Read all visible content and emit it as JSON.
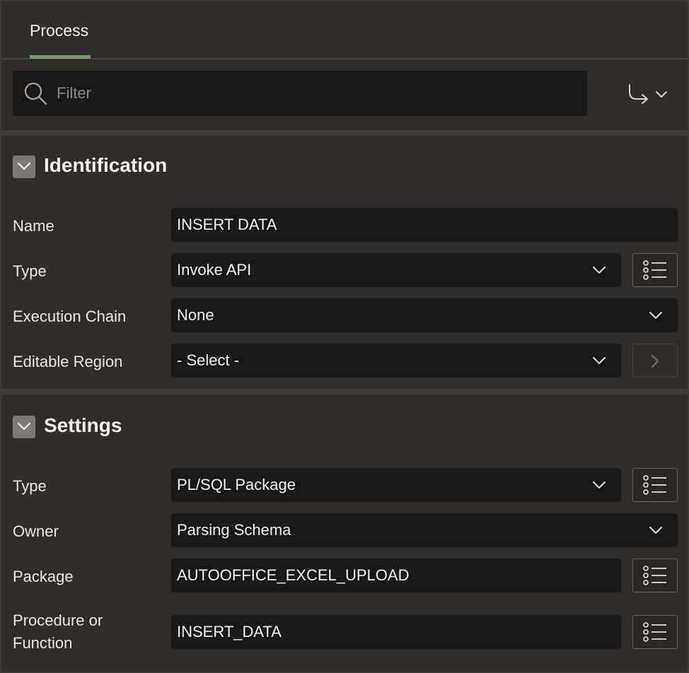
{
  "tabs": [
    {
      "label": "Process",
      "active": true
    }
  ],
  "filter": {
    "placeholder": "Filter"
  },
  "sections": {
    "identification": {
      "title": "Identification",
      "fields": {
        "name": {
          "label": "Name",
          "value": "INSERT DATA"
        },
        "type": {
          "label": "Type",
          "value": "Invoke API"
        },
        "execution_chain": {
          "label": "Execution Chain",
          "value": "None"
        },
        "editable_region": {
          "label": "Editable Region",
          "value": "- Select -"
        }
      }
    },
    "settings": {
      "title": "Settings",
      "fields": {
        "type": {
          "label": "Type",
          "value": "PL/SQL Package"
        },
        "owner": {
          "label": "Owner",
          "value": "Parsing Schema"
        },
        "package": {
          "label": "Package",
          "value": "AUTOOFFICE_EXCEL_UPLOAD"
        },
        "procedure": {
          "label_line1": "Procedure or",
          "label_line2": "Function",
          "value": "INSERT_DATA"
        }
      }
    }
  },
  "icons": {
    "search": "search-icon",
    "goto": "goto-arrow-icon",
    "collapse": "chevron-down-icon",
    "lov": "list-icon",
    "next": "chevron-right-icon"
  },
  "colors": {
    "panel_bg": "#312d2a",
    "field_bg": "#1b1918",
    "tab_accent": "#7a9a6e",
    "text": "#eae7e3"
  }
}
